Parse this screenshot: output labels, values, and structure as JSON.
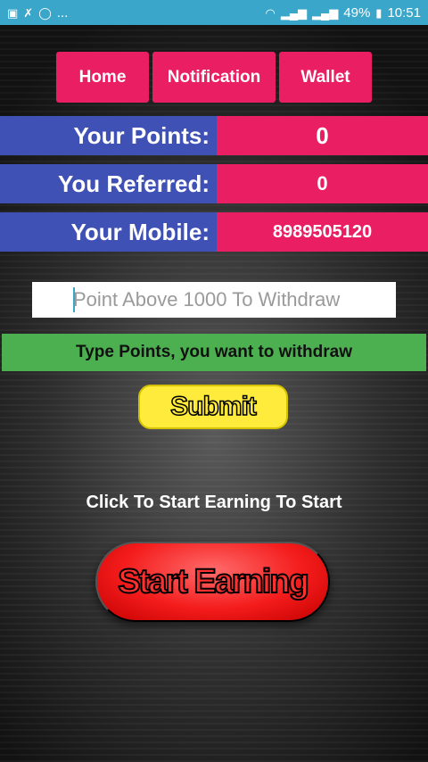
{
  "status_bar": {
    "left_icons": [
      "image-icon",
      "missed-call-icon",
      "whatsapp-icon"
    ],
    "ellipsis": "...",
    "battery": "49%",
    "time": "10:51"
  },
  "nav": {
    "home_label": "Home",
    "notification_label": "Notification",
    "wallet_label": "Wallet"
  },
  "info": {
    "points_label": "Your Points:",
    "points_value": "0",
    "referred_label": "You Referred:",
    "referred_value": "0",
    "mobile_label": "Your Mobile:",
    "mobile_value": "8989505120"
  },
  "withdraw": {
    "placeholder": "Point Above 1000 To Withdraw",
    "hint": "Type Points, you want to withdraw",
    "submit_label": "Submit"
  },
  "earning": {
    "caption": "Click To Start Earning To Start",
    "button_label": "Start Earning"
  },
  "colors": {
    "status_bar": "#3aa6c9",
    "pink": "#e91e63",
    "indigo": "#3f51b5",
    "green": "#4caf50",
    "yellow": "#ffeb3b",
    "red": "#f41c1c"
  }
}
